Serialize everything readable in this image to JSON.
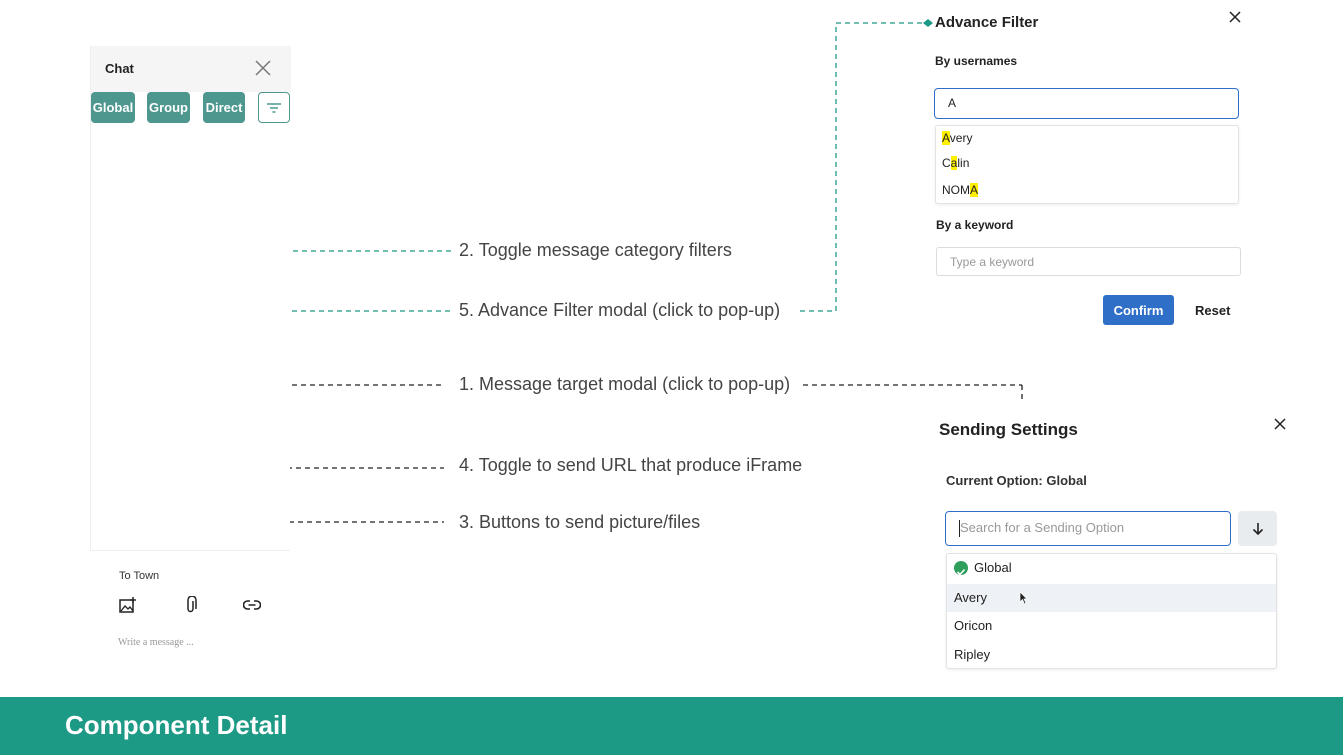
{
  "chat": {
    "title": "Chat",
    "tabs": [
      "Global",
      "Group",
      "Direct"
    ],
    "target_label": "To Town",
    "message_placeholder": "Write a message ..."
  },
  "annotations": {
    "toggle_filters": "2. Toggle message category filters",
    "advance_filter": "5. Advance Filter modal (click to pop-up)",
    "message_target": "1. Message target modal (click to pop-up)",
    "toggle_url": "4. Toggle to send URL that produce iFrame",
    "send_buttons": "3. Buttons to send picture/files"
  },
  "advance_filter": {
    "title": "Advance Filter",
    "by_usernames_label": "By usernames",
    "username_query": "A",
    "suggestions": [
      {
        "pre": "",
        "match": "A",
        "post": "very"
      },
      {
        "pre": "C",
        "match": "a",
        "post": "lin"
      },
      {
        "pre": "NOM",
        "match": "A",
        "post": ""
      }
    ],
    "by_keyword_label": "By a keyword",
    "keyword_placeholder": "Type a keyword",
    "confirm_label": "Confirm",
    "reset_label": "Reset"
  },
  "sending_settings": {
    "title": "Sending Settings",
    "current_option": "Current Option: Global",
    "search_placeholder": "Search for a Sending Option",
    "options": [
      "Global",
      "Avery",
      "Oricon",
      "Ripley"
    ],
    "selected": "Global",
    "hovered": "Avery"
  },
  "footer": {
    "title": "Component Detail"
  },
  "colors": {
    "teal": "#4e978f",
    "footer": "#1c9a85",
    "blue": "#2f6fc8",
    "highlight": "#ffef00",
    "check": "#2e9e5b"
  },
  "icons": [
    "close-icon",
    "filter-icon",
    "image-add-icon",
    "paperclip-icon",
    "link-icon",
    "arrow-down-icon",
    "check-circle-icon",
    "mouse-cursor-icon"
  ]
}
